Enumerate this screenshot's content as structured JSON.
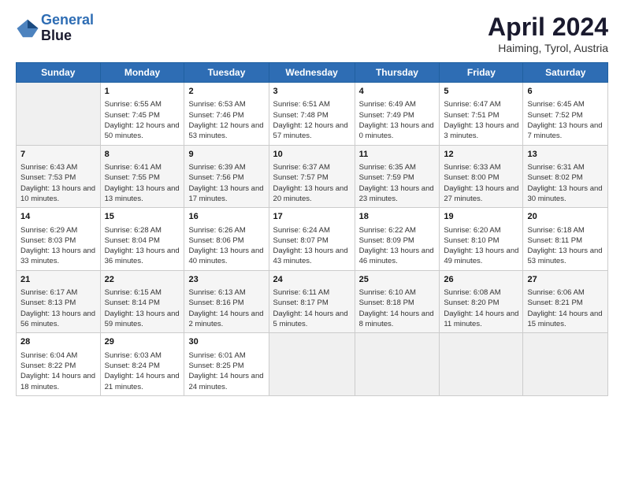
{
  "header": {
    "logo_line1": "General",
    "logo_line2": "Blue",
    "month_title": "April 2024",
    "location": "Haiming, Tyrol, Austria"
  },
  "weekdays": [
    "Sunday",
    "Monday",
    "Tuesday",
    "Wednesday",
    "Thursday",
    "Friday",
    "Saturday"
  ],
  "weeks": [
    [
      {
        "day": "",
        "empty": true
      },
      {
        "day": "1",
        "sunrise": "Sunrise: 6:55 AM",
        "sunset": "Sunset: 7:45 PM",
        "daylight": "Daylight: 12 hours and 50 minutes."
      },
      {
        "day": "2",
        "sunrise": "Sunrise: 6:53 AM",
        "sunset": "Sunset: 7:46 PM",
        "daylight": "Daylight: 12 hours and 53 minutes."
      },
      {
        "day": "3",
        "sunrise": "Sunrise: 6:51 AM",
        "sunset": "Sunset: 7:48 PM",
        "daylight": "Daylight: 12 hours and 57 minutes."
      },
      {
        "day": "4",
        "sunrise": "Sunrise: 6:49 AM",
        "sunset": "Sunset: 7:49 PM",
        "daylight": "Daylight: 13 hours and 0 minutes."
      },
      {
        "day": "5",
        "sunrise": "Sunrise: 6:47 AM",
        "sunset": "Sunset: 7:51 PM",
        "daylight": "Daylight: 13 hours and 3 minutes."
      },
      {
        "day": "6",
        "sunrise": "Sunrise: 6:45 AM",
        "sunset": "Sunset: 7:52 PM",
        "daylight": "Daylight: 13 hours and 7 minutes."
      }
    ],
    [
      {
        "day": "7",
        "sunrise": "Sunrise: 6:43 AM",
        "sunset": "Sunset: 7:53 PM",
        "daylight": "Daylight: 13 hours and 10 minutes."
      },
      {
        "day": "8",
        "sunrise": "Sunrise: 6:41 AM",
        "sunset": "Sunset: 7:55 PM",
        "daylight": "Daylight: 13 hours and 13 minutes."
      },
      {
        "day": "9",
        "sunrise": "Sunrise: 6:39 AM",
        "sunset": "Sunset: 7:56 PM",
        "daylight": "Daylight: 13 hours and 17 minutes."
      },
      {
        "day": "10",
        "sunrise": "Sunrise: 6:37 AM",
        "sunset": "Sunset: 7:57 PM",
        "daylight": "Daylight: 13 hours and 20 minutes."
      },
      {
        "day": "11",
        "sunrise": "Sunrise: 6:35 AM",
        "sunset": "Sunset: 7:59 PM",
        "daylight": "Daylight: 13 hours and 23 minutes."
      },
      {
        "day": "12",
        "sunrise": "Sunrise: 6:33 AM",
        "sunset": "Sunset: 8:00 PM",
        "daylight": "Daylight: 13 hours and 27 minutes."
      },
      {
        "day": "13",
        "sunrise": "Sunrise: 6:31 AM",
        "sunset": "Sunset: 8:02 PM",
        "daylight": "Daylight: 13 hours and 30 minutes."
      }
    ],
    [
      {
        "day": "14",
        "sunrise": "Sunrise: 6:29 AM",
        "sunset": "Sunset: 8:03 PM",
        "daylight": "Daylight: 13 hours and 33 minutes."
      },
      {
        "day": "15",
        "sunrise": "Sunrise: 6:28 AM",
        "sunset": "Sunset: 8:04 PM",
        "daylight": "Daylight: 13 hours and 36 minutes."
      },
      {
        "day": "16",
        "sunrise": "Sunrise: 6:26 AM",
        "sunset": "Sunset: 8:06 PM",
        "daylight": "Daylight: 13 hours and 40 minutes."
      },
      {
        "day": "17",
        "sunrise": "Sunrise: 6:24 AM",
        "sunset": "Sunset: 8:07 PM",
        "daylight": "Daylight: 13 hours and 43 minutes."
      },
      {
        "day": "18",
        "sunrise": "Sunrise: 6:22 AM",
        "sunset": "Sunset: 8:09 PM",
        "daylight": "Daylight: 13 hours and 46 minutes."
      },
      {
        "day": "19",
        "sunrise": "Sunrise: 6:20 AM",
        "sunset": "Sunset: 8:10 PM",
        "daylight": "Daylight: 13 hours and 49 minutes."
      },
      {
        "day": "20",
        "sunrise": "Sunrise: 6:18 AM",
        "sunset": "Sunset: 8:11 PM",
        "daylight": "Daylight: 13 hours and 53 minutes."
      }
    ],
    [
      {
        "day": "21",
        "sunrise": "Sunrise: 6:17 AM",
        "sunset": "Sunset: 8:13 PM",
        "daylight": "Daylight: 13 hours and 56 minutes."
      },
      {
        "day": "22",
        "sunrise": "Sunrise: 6:15 AM",
        "sunset": "Sunset: 8:14 PM",
        "daylight": "Daylight: 13 hours and 59 minutes."
      },
      {
        "day": "23",
        "sunrise": "Sunrise: 6:13 AM",
        "sunset": "Sunset: 8:16 PM",
        "daylight": "Daylight: 14 hours and 2 minutes."
      },
      {
        "day": "24",
        "sunrise": "Sunrise: 6:11 AM",
        "sunset": "Sunset: 8:17 PM",
        "daylight": "Daylight: 14 hours and 5 minutes."
      },
      {
        "day": "25",
        "sunrise": "Sunrise: 6:10 AM",
        "sunset": "Sunset: 8:18 PM",
        "daylight": "Daylight: 14 hours and 8 minutes."
      },
      {
        "day": "26",
        "sunrise": "Sunrise: 6:08 AM",
        "sunset": "Sunset: 8:20 PM",
        "daylight": "Daylight: 14 hours and 11 minutes."
      },
      {
        "day": "27",
        "sunrise": "Sunrise: 6:06 AM",
        "sunset": "Sunset: 8:21 PM",
        "daylight": "Daylight: 14 hours and 15 minutes."
      }
    ],
    [
      {
        "day": "28",
        "sunrise": "Sunrise: 6:04 AM",
        "sunset": "Sunset: 8:22 PM",
        "daylight": "Daylight: 14 hours and 18 minutes."
      },
      {
        "day": "29",
        "sunrise": "Sunrise: 6:03 AM",
        "sunset": "Sunset: 8:24 PM",
        "daylight": "Daylight: 14 hours and 21 minutes."
      },
      {
        "day": "30",
        "sunrise": "Sunrise: 6:01 AM",
        "sunset": "Sunset: 8:25 PM",
        "daylight": "Daylight: 14 hours and 24 minutes."
      },
      {
        "day": "",
        "empty": true
      },
      {
        "day": "",
        "empty": true
      },
      {
        "day": "",
        "empty": true
      },
      {
        "day": "",
        "empty": true
      }
    ]
  ]
}
